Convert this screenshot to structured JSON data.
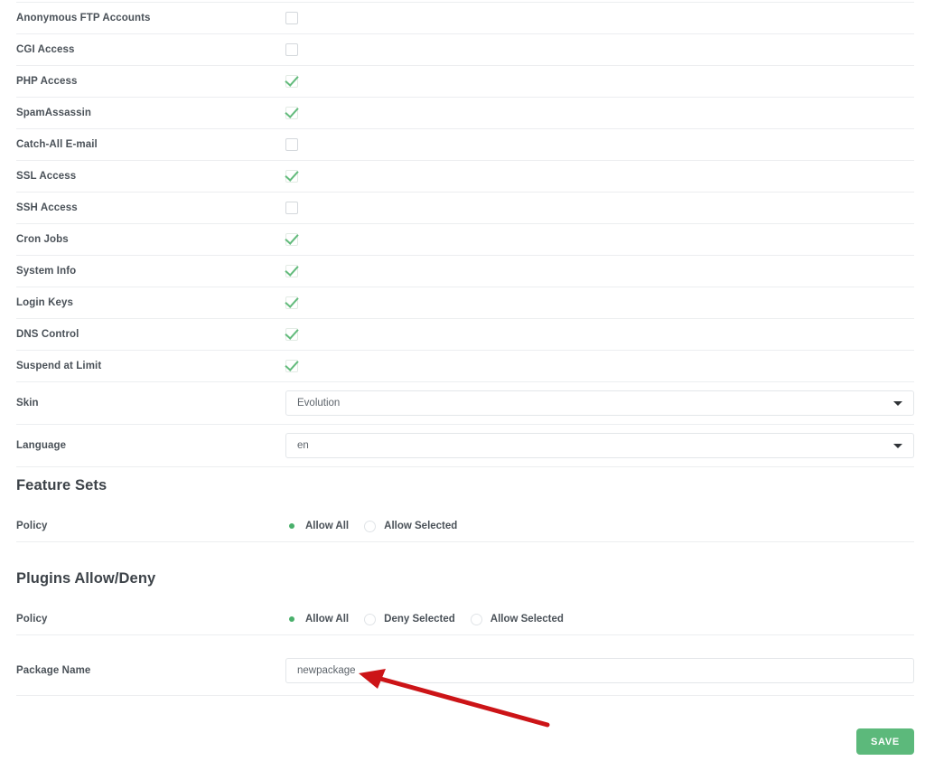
{
  "features": [
    {
      "label": "Anonymous FTP Accounts",
      "checked": false
    },
    {
      "label": "CGI Access",
      "checked": false
    },
    {
      "label": "PHP Access",
      "checked": true
    },
    {
      "label": "SpamAssassin",
      "checked": true
    },
    {
      "label": "Catch-All E-mail",
      "checked": false
    },
    {
      "label": "SSL Access",
      "checked": true
    },
    {
      "label": "SSH Access",
      "checked": false
    },
    {
      "label": "Cron Jobs",
      "checked": true
    },
    {
      "label": "System Info",
      "checked": true
    },
    {
      "label": "Login Keys",
      "checked": true
    },
    {
      "label": "DNS Control",
      "checked": true
    },
    {
      "label": "Suspend at Limit",
      "checked": true
    }
  ],
  "selects": [
    {
      "label": "Skin",
      "value": "Evolution",
      "icon": "chevron-down-icon"
    },
    {
      "label": "Language",
      "value": "en",
      "icon": "chevron-down-icon"
    }
  ],
  "feature_sets": {
    "title": "Feature Sets",
    "policy_label": "Policy",
    "options": [
      {
        "label": "Allow All",
        "selected": true
      },
      {
        "label": "Allow Selected",
        "selected": false
      }
    ]
  },
  "plugins": {
    "title": "Plugins Allow/Deny",
    "policy_label": "Policy",
    "options": [
      {
        "label": "Allow All",
        "selected": true
      },
      {
        "label": "Deny Selected",
        "selected": false
      },
      {
        "label": "Allow Selected",
        "selected": false
      }
    ]
  },
  "package": {
    "label": "Package Name",
    "value": "newpackage",
    "placeholder": "Package Name"
  },
  "actions": {
    "save_label": "SAVE"
  },
  "annotation": {
    "name": "red-arrow-annotation",
    "color": "#cc1417",
    "points_to": "Package Name input"
  },
  "colors": {
    "accent_green": "#5cb97b",
    "check_green": "#63bb7c",
    "radio_green": "#49b06b",
    "text": "#4a5158",
    "border": "#e3e6e9",
    "separator": "#eceef0",
    "annotation_red": "#cc1417"
  }
}
